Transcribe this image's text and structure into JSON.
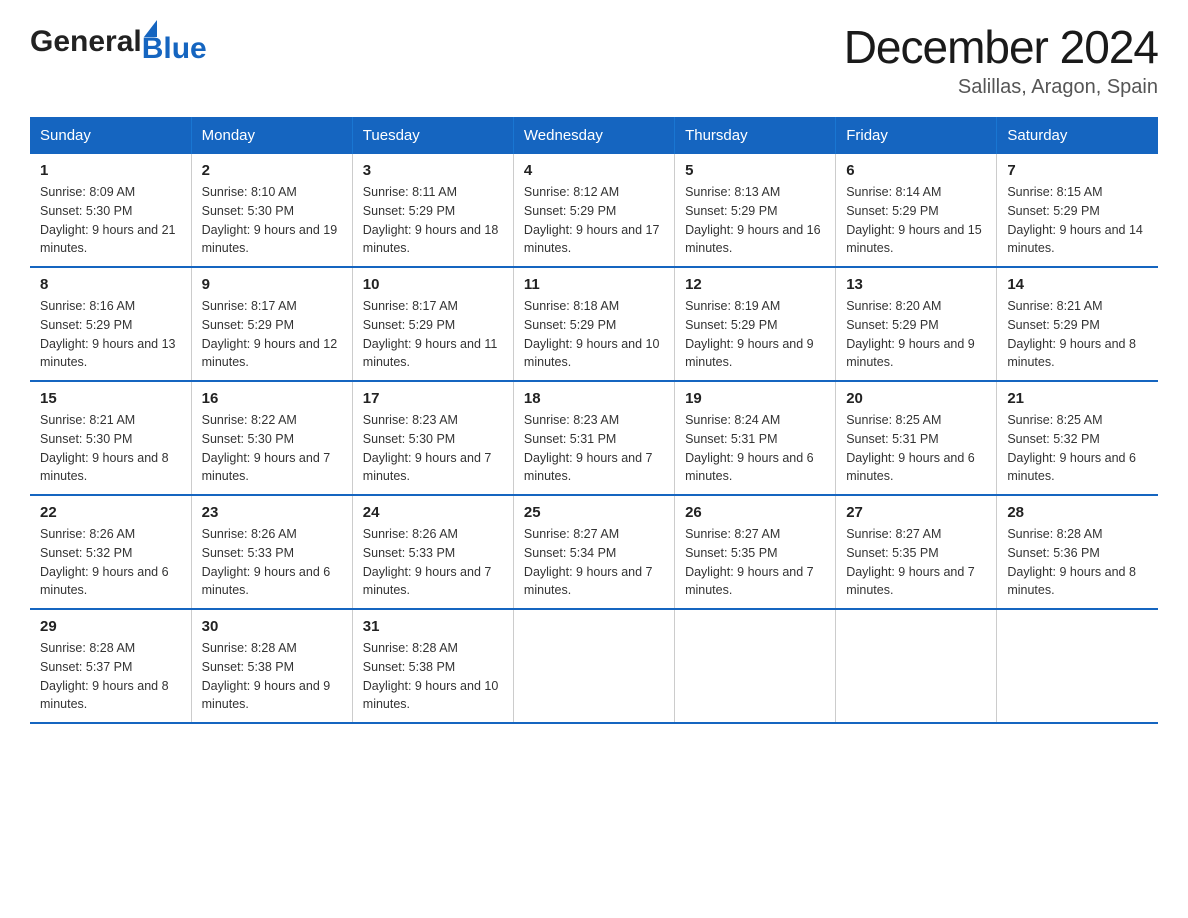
{
  "header": {
    "logo_general": "General",
    "logo_blue": "Blue",
    "month_title": "December 2024",
    "location": "Salillas, Aragon, Spain"
  },
  "weekdays": [
    "Sunday",
    "Monday",
    "Tuesday",
    "Wednesday",
    "Thursday",
    "Friday",
    "Saturday"
  ],
  "weeks": [
    [
      {
        "day": "1",
        "sunrise": "Sunrise: 8:09 AM",
        "sunset": "Sunset: 5:30 PM",
        "daylight": "Daylight: 9 hours and 21 minutes."
      },
      {
        "day": "2",
        "sunrise": "Sunrise: 8:10 AM",
        "sunset": "Sunset: 5:30 PM",
        "daylight": "Daylight: 9 hours and 19 minutes."
      },
      {
        "day": "3",
        "sunrise": "Sunrise: 8:11 AM",
        "sunset": "Sunset: 5:29 PM",
        "daylight": "Daylight: 9 hours and 18 minutes."
      },
      {
        "day": "4",
        "sunrise": "Sunrise: 8:12 AM",
        "sunset": "Sunset: 5:29 PM",
        "daylight": "Daylight: 9 hours and 17 minutes."
      },
      {
        "day": "5",
        "sunrise": "Sunrise: 8:13 AM",
        "sunset": "Sunset: 5:29 PM",
        "daylight": "Daylight: 9 hours and 16 minutes."
      },
      {
        "day": "6",
        "sunrise": "Sunrise: 8:14 AM",
        "sunset": "Sunset: 5:29 PM",
        "daylight": "Daylight: 9 hours and 15 minutes."
      },
      {
        "day": "7",
        "sunrise": "Sunrise: 8:15 AM",
        "sunset": "Sunset: 5:29 PM",
        "daylight": "Daylight: 9 hours and 14 minutes."
      }
    ],
    [
      {
        "day": "8",
        "sunrise": "Sunrise: 8:16 AM",
        "sunset": "Sunset: 5:29 PM",
        "daylight": "Daylight: 9 hours and 13 minutes."
      },
      {
        "day": "9",
        "sunrise": "Sunrise: 8:17 AM",
        "sunset": "Sunset: 5:29 PM",
        "daylight": "Daylight: 9 hours and 12 minutes."
      },
      {
        "day": "10",
        "sunrise": "Sunrise: 8:17 AM",
        "sunset": "Sunset: 5:29 PM",
        "daylight": "Daylight: 9 hours and 11 minutes."
      },
      {
        "day": "11",
        "sunrise": "Sunrise: 8:18 AM",
        "sunset": "Sunset: 5:29 PM",
        "daylight": "Daylight: 9 hours and 10 minutes."
      },
      {
        "day": "12",
        "sunrise": "Sunrise: 8:19 AM",
        "sunset": "Sunset: 5:29 PM",
        "daylight": "Daylight: 9 hours and 9 minutes."
      },
      {
        "day": "13",
        "sunrise": "Sunrise: 8:20 AM",
        "sunset": "Sunset: 5:29 PM",
        "daylight": "Daylight: 9 hours and 9 minutes."
      },
      {
        "day": "14",
        "sunrise": "Sunrise: 8:21 AM",
        "sunset": "Sunset: 5:29 PM",
        "daylight": "Daylight: 9 hours and 8 minutes."
      }
    ],
    [
      {
        "day": "15",
        "sunrise": "Sunrise: 8:21 AM",
        "sunset": "Sunset: 5:30 PM",
        "daylight": "Daylight: 9 hours and 8 minutes."
      },
      {
        "day": "16",
        "sunrise": "Sunrise: 8:22 AM",
        "sunset": "Sunset: 5:30 PM",
        "daylight": "Daylight: 9 hours and 7 minutes."
      },
      {
        "day": "17",
        "sunrise": "Sunrise: 8:23 AM",
        "sunset": "Sunset: 5:30 PM",
        "daylight": "Daylight: 9 hours and 7 minutes."
      },
      {
        "day": "18",
        "sunrise": "Sunrise: 8:23 AM",
        "sunset": "Sunset: 5:31 PM",
        "daylight": "Daylight: 9 hours and 7 minutes."
      },
      {
        "day": "19",
        "sunrise": "Sunrise: 8:24 AM",
        "sunset": "Sunset: 5:31 PM",
        "daylight": "Daylight: 9 hours and 6 minutes."
      },
      {
        "day": "20",
        "sunrise": "Sunrise: 8:25 AM",
        "sunset": "Sunset: 5:31 PM",
        "daylight": "Daylight: 9 hours and 6 minutes."
      },
      {
        "day": "21",
        "sunrise": "Sunrise: 8:25 AM",
        "sunset": "Sunset: 5:32 PM",
        "daylight": "Daylight: 9 hours and 6 minutes."
      }
    ],
    [
      {
        "day": "22",
        "sunrise": "Sunrise: 8:26 AM",
        "sunset": "Sunset: 5:32 PM",
        "daylight": "Daylight: 9 hours and 6 minutes."
      },
      {
        "day": "23",
        "sunrise": "Sunrise: 8:26 AM",
        "sunset": "Sunset: 5:33 PM",
        "daylight": "Daylight: 9 hours and 6 minutes."
      },
      {
        "day": "24",
        "sunrise": "Sunrise: 8:26 AM",
        "sunset": "Sunset: 5:33 PM",
        "daylight": "Daylight: 9 hours and 7 minutes."
      },
      {
        "day": "25",
        "sunrise": "Sunrise: 8:27 AM",
        "sunset": "Sunset: 5:34 PM",
        "daylight": "Daylight: 9 hours and 7 minutes."
      },
      {
        "day": "26",
        "sunrise": "Sunrise: 8:27 AM",
        "sunset": "Sunset: 5:35 PM",
        "daylight": "Daylight: 9 hours and 7 minutes."
      },
      {
        "day": "27",
        "sunrise": "Sunrise: 8:27 AM",
        "sunset": "Sunset: 5:35 PM",
        "daylight": "Daylight: 9 hours and 7 minutes."
      },
      {
        "day": "28",
        "sunrise": "Sunrise: 8:28 AM",
        "sunset": "Sunset: 5:36 PM",
        "daylight": "Daylight: 9 hours and 8 minutes."
      }
    ],
    [
      {
        "day": "29",
        "sunrise": "Sunrise: 8:28 AM",
        "sunset": "Sunset: 5:37 PM",
        "daylight": "Daylight: 9 hours and 8 minutes."
      },
      {
        "day": "30",
        "sunrise": "Sunrise: 8:28 AM",
        "sunset": "Sunset: 5:38 PM",
        "daylight": "Daylight: 9 hours and 9 minutes."
      },
      {
        "day": "31",
        "sunrise": "Sunrise: 8:28 AM",
        "sunset": "Sunset: 5:38 PM",
        "daylight": "Daylight: 9 hours and 10 minutes."
      },
      {
        "day": "",
        "sunrise": "",
        "sunset": "",
        "daylight": ""
      },
      {
        "day": "",
        "sunrise": "",
        "sunset": "",
        "daylight": ""
      },
      {
        "day": "",
        "sunrise": "",
        "sunset": "",
        "daylight": ""
      },
      {
        "day": "",
        "sunrise": "",
        "sunset": "",
        "daylight": ""
      }
    ]
  ]
}
